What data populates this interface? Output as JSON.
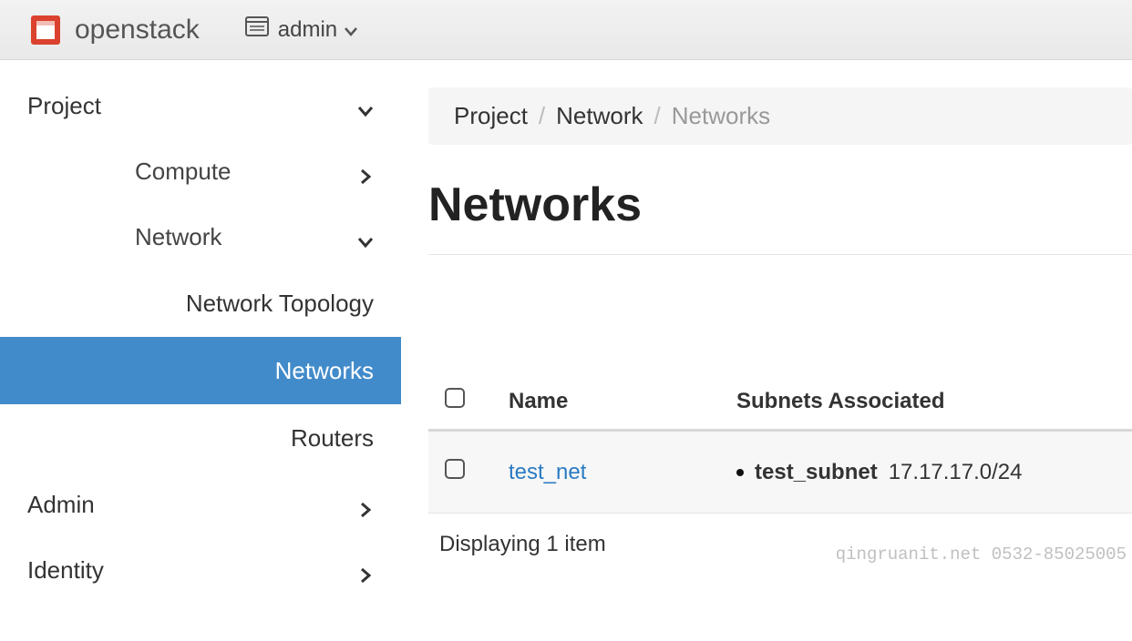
{
  "header": {
    "brand": "openstack",
    "project_selector": "admin"
  },
  "sidebar": {
    "items": [
      {
        "label": "Project",
        "level": 1,
        "chev": "down"
      },
      {
        "label": "Compute",
        "level": 2,
        "chev": "right"
      },
      {
        "label": "Network",
        "level": 2,
        "chev": "down"
      },
      {
        "label": "Network Topology",
        "level": 3,
        "active": false
      },
      {
        "label": "Networks",
        "level": 3,
        "active": true
      },
      {
        "label": "Routers",
        "level": 3,
        "active": false
      },
      {
        "label": "Admin",
        "level": 1,
        "chev": "right"
      },
      {
        "label": "Identity",
        "level": 1,
        "chev": "right"
      }
    ]
  },
  "breadcrumb": {
    "parts": [
      "Project",
      "Network",
      "Networks"
    ]
  },
  "page_title": "Networks",
  "table": {
    "columns": [
      "Name",
      "Subnets Associated"
    ],
    "rows": [
      {
        "name": "test_net",
        "subnets": [
          {
            "name": "test_subnet",
            "cidr": "17.17.17.0/24"
          }
        ]
      }
    ],
    "footer": "Displaying 1 item"
  },
  "watermark": "qingruanit.net 0532-85025005"
}
